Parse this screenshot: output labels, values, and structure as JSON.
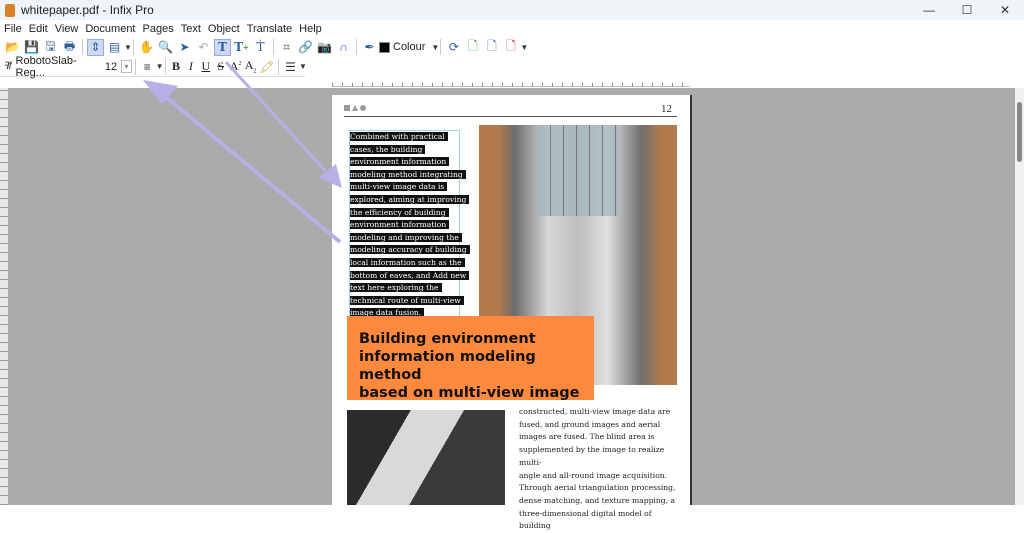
{
  "window": {
    "title": "whitepaper.pdf - Infix Pro",
    "controls": [
      "—",
      "☐",
      "✕"
    ]
  },
  "menu": [
    "File",
    "Edit",
    "View",
    "Document",
    "Pages",
    "Text",
    "Object",
    "Translate",
    "Help"
  ],
  "toolbar": {
    "colour_label": "Colour"
  },
  "format_bar": {
    "font_name": "RobotoSlab-Reg...",
    "font_size": "12"
  },
  "page": {
    "page_number": "12",
    "selected_text_lines": [
      "Combined with practical",
      "cases, the building",
      "environment information",
      "modeling method integrating",
      "multi-view image data is",
      "explored, aiming at improving",
      "the efficiency of building",
      "environment information",
      "modeling and improving the",
      "modeling accuracy of building",
      "local information such as the",
      "bottom of eaves, and Add new",
      "text  here exploring the",
      "technical route of multi-view",
      "image data fusion."
    ],
    "banner_lines": [
      "Building environment",
      "information modeling method",
      "based on multi-view image"
    ],
    "body_lines": [
      "constructed, multi-view image data are",
      "fused, and ground images and aerial",
      "images are fused. The blind area is",
      "supplemented by the image to realize multi-",
      "angle and all-round image acquisition.",
      "Through aerial triangulation processing,",
      "dense matching, and texture mapping, a",
      "three-dimensional digital model of building"
    ]
  },
  "colors": {
    "banner": "#ff8a3d",
    "annotation_arrow": "#b9aee6",
    "workspace": "#ababab"
  }
}
